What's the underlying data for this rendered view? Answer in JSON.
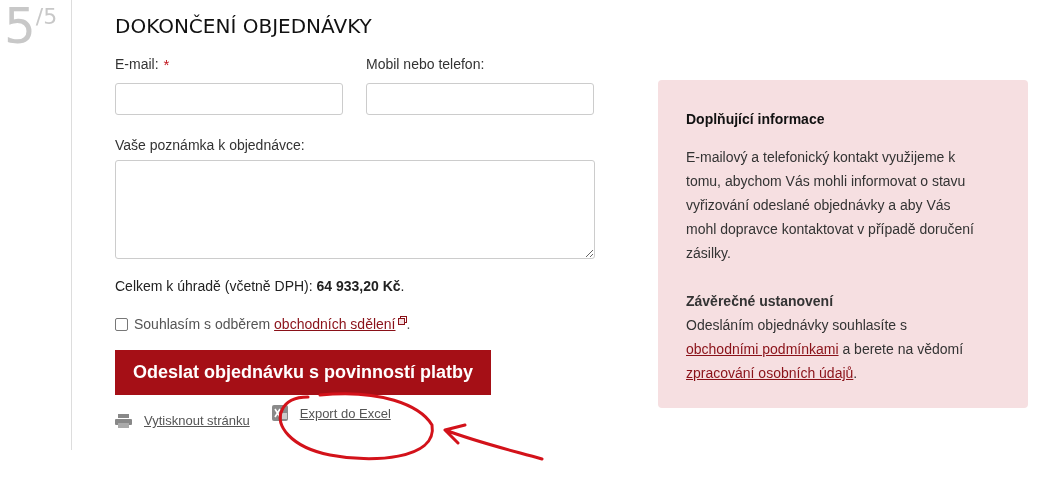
{
  "step": {
    "number": "5",
    "total": "/5"
  },
  "title": "DOKONČENÍ OBJEDNÁVKY",
  "fields": [
    {
      "label": "E-mail:",
      "required_mark": "*"
    },
    {
      "label": "Mobil nebo telefon:"
    }
  ],
  "note": {
    "label": "Vaše poznámka k objednávce:"
  },
  "total": "Celkem k úhradě (včetně DPH): **64 933,20 Kč**.",
  "consent": {
    "checked": false,
    "before": "Souhlasím s odběrem ",
    "link": "obchodních sdělení",
    "after": "."
  },
  "submit_button": "Odeslat objednávku s povinností platby",
  "links": [
    {
      "kind": "print",
      "label": "Vytisknout stránku"
    },
    {
      "kind": "excel",
      "label": "Export do Excel"
    }
  ],
  "info_panel": {
    "title": "Doplňující informace",
    "text": "E-mailový a telefonický kontakt využijeme k tomu, abychom Vás mohli informovat o stavu vyřizování odeslané objednávky a aby Vás mohl dopravce kontaktovat v případě doručení zásilky.",
    "closing_title": "Závěrečné ustanovení",
    "closing": [
      {
        "kind": "text",
        "text": "Odesláním objednávky souhlasíte s "
      },
      {
        "kind": "link",
        "text": "obchodními podmínkami"
      },
      {
        "kind": "text",
        "text": " a berete na vědomí "
      },
      {
        "kind": "link",
        "text": "zpracování osobních údajů"
      },
      {
        "kind": "text",
        "text": "."
      }
    ]
  }
}
